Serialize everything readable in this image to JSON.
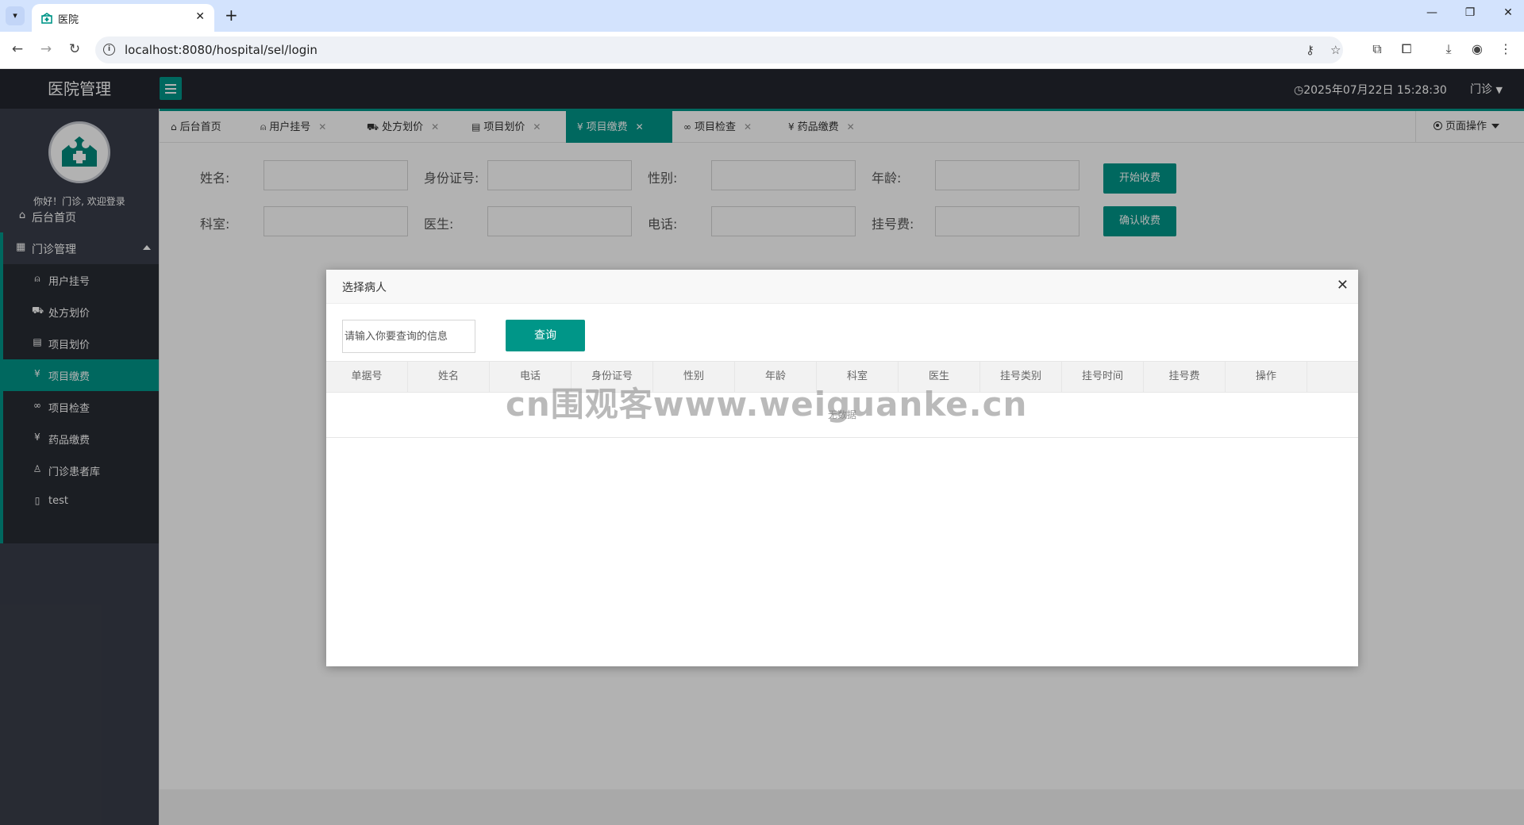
{
  "browser": {
    "tab_title": "医院",
    "url": "localhost:8080/hospital/sel/login"
  },
  "app": {
    "logo": "医院管理",
    "datetime": "2025年07月22日 15:28:30",
    "user_menu": "门诊"
  },
  "sidebar": {
    "greeting": "你好！门诊, 欢迎登录",
    "home": "后台首页",
    "group": "门诊管理",
    "items": [
      {
        "label": "用户挂号",
        "icon": "user-icon"
      },
      {
        "label": "处方划价",
        "icon": "cart-icon"
      },
      {
        "label": "项目划价",
        "icon": "doc-icon"
      },
      {
        "label": "项目缴费",
        "icon": "yen-icon"
      },
      {
        "label": "项目检查",
        "icon": "link-icon"
      },
      {
        "label": "药品缴费",
        "icon": "yen-icon"
      },
      {
        "label": "门诊患者库",
        "icon": "person-icon"
      },
      {
        "label": "test",
        "icon": "tablet-icon"
      }
    ]
  },
  "tabs": [
    {
      "label": "后台首页"
    },
    {
      "label": "用户挂号"
    },
    {
      "label": "处方划价"
    },
    {
      "label": "项目划价"
    },
    {
      "label": "项目缴费"
    },
    {
      "label": "项目检查"
    },
    {
      "label": "药品缴费"
    }
  ],
  "page_ops": "页面操作",
  "form": {
    "name_label": "姓名:",
    "idcard_label": "身份证号:",
    "gender_label": "性别:",
    "age_label": "年龄:",
    "dept_label": "科室:",
    "doctor_label": "医生:",
    "phone_label": "电话:",
    "fee_label": "挂号费:",
    "start_btn": "开始收费",
    "confirm_btn": "确认收费"
  },
  "modal": {
    "title": "选择病人",
    "search_placeholder": "请输入你要查询的信息",
    "search_btn": "查询",
    "columns": [
      "单据号",
      "姓名",
      "电话",
      "身份证号",
      "性别",
      "年龄",
      "科室",
      "医生",
      "挂号类别",
      "挂号时间",
      "挂号费",
      "操作"
    ],
    "empty": "无数据"
  },
  "watermark": "cn围观客www.weiguanke.cn",
  "colors": {
    "accent": "#009688",
    "topbar": "#23262e",
    "sidebar": "#393d49"
  }
}
